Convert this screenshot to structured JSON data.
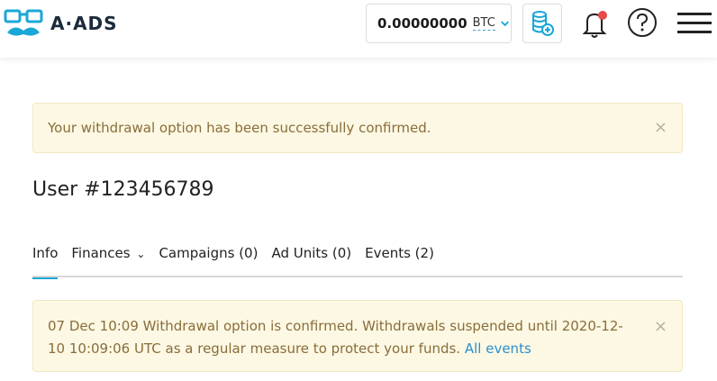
{
  "header": {
    "logo_text": "A·ADS",
    "balance_amount": "0.00000000",
    "balance_currency": "BTC",
    "icons": [
      "logo-mustache-icon",
      "chevron-down-icon",
      "coins-add-icon",
      "bell-icon",
      "help-icon",
      "hamburger-menu-icon"
    ],
    "notification_dot_color": "#e84a4a"
  },
  "alerts": [
    {
      "text": "Your withdrawal option has been successfully confirmed.",
      "close": "×"
    },
    {
      "text": "07 Dec 10:09 Withdrawal option is confirmed. Withdrawals suspended until 2020-12-10 10:09:06 UTC as a regular measure to protect your funds.",
      "link": "All events",
      "close": "×"
    }
  ],
  "page": {
    "title": "User #123456789"
  },
  "tabs": [
    {
      "label": "Info",
      "active": true
    },
    {
      "label": "Finances",
      "has_dropdown": true,
      "chevron": "⌄"
    },
    {
      "label": "Campaigns (0)"
    },
    {
      "label": "Ad Units (0)"
    },
    {
      "label": "Events (2)"
    }
  ],
  "colors": {
    "accent": "#1aa7d8",
    "alert_bg": "#fcf8e3",
    "alert_text": "#8a6d3b",
    "link": "#2a8fd0"
  }
}
